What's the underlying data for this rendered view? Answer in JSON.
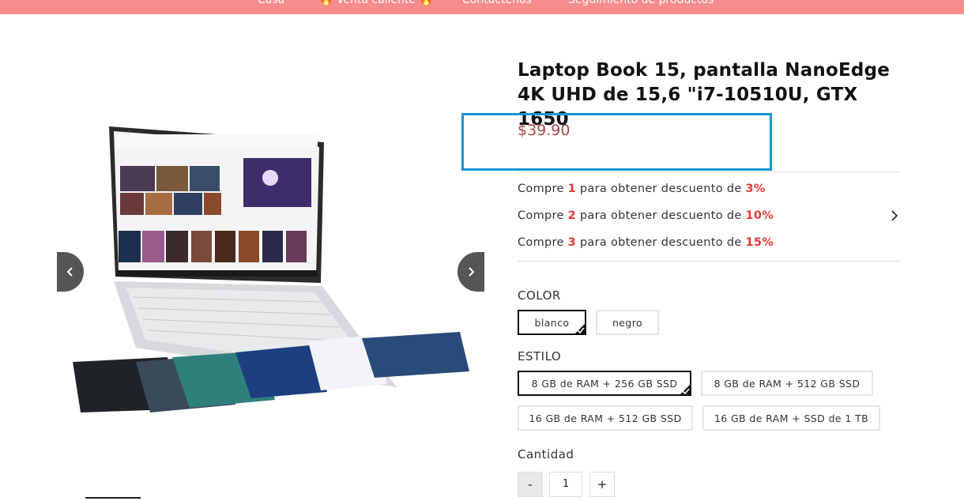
{
  "nav": {
    "items": [
      "Casa",
      "🔥 Venta caliente 🔥",
      "Contáctenos",
      "Seguimiento de productos"
    ]
  },
  "product": {
    "title": "Laptop Book 15, pantalla NanoEdge 4K UHD de 15,6 \"i7-10510U, GTX 1650",
    "price": "$39.90"
  },
  "discounts": [
    {
      "prefix": "Compre ",
      "qty": "1",
      "middle": " para obtener descuento de ",
      "pct": "3%"
    },
    {
      "prefix": "Compre ",
      "qty": "2",
      "middle": " para obtener descuento de ",
      "pct": "10%"
    },
    {
      "prefix": "Compre ",
      "qty": "3",
      "middle": " para obtener descuento de ",
      "pct": "15%"
    }
  ],
  "color": {
    "label": "COLOR",
    "options": [
      "blanco",
      "negro"
    ],
    "selected": "blanco"
  },
  "style": {
    "label": "ESTILO",
    "options": [
      "8 GB de RAM + 256 GB SSD",
      "8 GB de RAM + 512 GB SSD",
      "16 GB de RAM + 512 GB SSD",
      "16 GB de RAM + SSD de 1 TB"
    ],
    "selected": "8 GB de RAM + 256 GB SSD"
  },
  "quantity": {
    "label": "Cantidad",
    "value": "1",
    "minus": "-",
    "plus": "+"
  },
  "colors": {
    "topbar": "#f78c8c",
    "price": "#a5474c",
    "highlight_box": "#1a96d4",
    "discount_accent": "#e53935"
  }
}
